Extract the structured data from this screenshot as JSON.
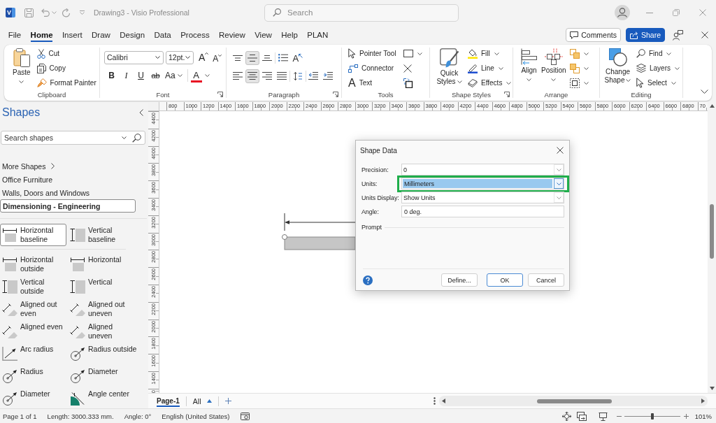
{
  "title_bar": {
    "logo": "V",
    "title": "Drawing3 - Visio Professional",
    "search": {
      "placeholder": "Search"
    }
  },
  "menu_tabs": [
    {
      "label": "File",
      "selected": false
    },
    {
      "label": "Home",
      "selected": true
    },
    {
      "label": "Insert",
      "selected": false
    },
    {
      "label": "Draw",
      "selected": false
    },
    {
      "label": "Design",
      "selected": false
    },
    {
      "label": "Data",
      "selected": false
    },
    {
      "label": "Process",
      "selected": false
    },
    {
      "label": "Review",
      "selected": false
    },
    {
      "label": "View",
      "selected": false
    },
    {
      "label": "Help",
      "selected": false
    },
    {
      "label": "PLAN",
      "selected": false
    }
  ],
  "header_buttons": [
    {
      "label": "Comments",
      "kind": "outline"
    },
    {
      "label": "Share",
      "kind": "primary"
    }
  ],
  "ribbon": {
    "groups": [
      {
        "kind": "clipboard",
        "label": "Clipboard",
        "big_button": "Paste",
        "buttons": [
          "Cut",
          "Copy",
          "Format Painter"
        ]
      },
      {
        "kind": "font",
        "label": "Font",
        "font": "Calibri",
        "size": "12pt.",
        "grow": "A",
        "shrink": "A",
        "styles": [
          "B",
          "I",
          "U",
          "ab",
          "Aa"
        ],
        "color_letter": "A"
      },
      {
        "kind": "paragraph",
        "label": "Paragraph",
        "vertical_align": [
          {
            "selected": false
          },
          {
            "selected": true
          },
          {
            "selected": false
          }
        ],
        "text_direction": "A",
        "horizontal_align": [
          {
            "selected": false
          },
          {
            "selected": true
          },
          {
            "selected": false
          },
          {
            "selected": false
          }
        ]
      },
      {
        "kind": "tools",
        "label": "Tools",
        "buttons": [
          "Pointer Tool",
          "Connector",
          "Text"
        ],
        "text_icon": "A"
      },
      {
        "kind": "shape_styles",
        "label": "Shape Styles",
        "big_button": "Quick Styles",
        "buttons": [
          "Fill",
          "Line",
          "Effects"
        ]
      },
      {
        "kind": "arrange",
        "label": "Arrange",
        "big_buttons": [
          "Align",
          "Position"
        ]
      },
      {
        "kind": "editing",
        "label": "Editing",
        "big_button": "Change Shape",
        "buttons": [
          "Find",
          "Layers",
          "Select"
        ]
      }
    ]
  },
  "shapes_panel": {
    "title": "Shapes",
    "search": {
      "placeholder": "Search shapes"
    },
    "more_shapes": "More Shapes",
    "stencils": [
      {
        "label": "Office Furniture",
        "selected": false
      },
      {
        "label": "Walls, Doors and Windows",
        "selected": false
      },
      {
        "label": "Dimensioning - Engineering",
        "selected": true
      }
    ],
    "master_groups": [
      {
        "items": [
          {
            "label": "Horizontal baseline",
            "selected": true
          },
          {
            "label": "Vertical baseline",
            "selected": false
          }
        ]
      },
      {
        "items": [
          {
            "label": "Horizontal outside",
            "selected": false
          },
          {
            "label": "Horizontal",
            "selected": false
          },
          {
            "label": "Vertical outside",
            "selected": false
          },
          {
            "label": "Vertical",
            "selected": false
          },
          {
            "label": "Aligned out even",
            "selected": false
          },
          {
            "label": "Aligned out uneven",
            "selected": false
          },
          {
            "label": "Aligned even",
            "selected": false
          },
          {
            "label": "Aligned uneven",
            "selected": false
          },
          {
            "label": "Arc radius",
            "selected": false
          },
          {
            "label": "Radius outside",
            "selected": false
          },
          {
            "label": "Radius",
            "selected": false
          },
          {
            "label": "Diameter",
            "selected": false
          },
          {
            "label": "Diameter",
            "selected": false
          },
          {
            "label": "Angle center",
            "selected": false
          }
        ]
      }
    ]
  },
  "rulers": {
    "horizontal": [
      "800",
      "1000",
      "1200",
      "1400",
      "1600",
      "1800",
      "2000",
      "2200",
      "2400",
      "2600",
      "2800",
      "3000",
      "3200",
      "3400",
      "3600",
      "3800",
      "4000",
      "4200",
      "4400",
      "4600",
      "4800",
      "5000",
      "5200",
      "5400",
      "5600",
      "5800",
      "6000",
      "6200",
      "6400",
      "6600",
      "6800",
      "70"
    ],
    "vertical": [
      "4400",
      "4200",
      "4000",
      "3800",
      "3600",
      "3400",
      "3200",
      "3000",
      "2800",
      "2600",
      "2400",
      "2200",
      "2000",
      "1800",
      "1600",
      "1400",
      "0"
    ]
  },
  "dialog": {
    "title": "Shape Data",
    "fields": [
      {
        "label": "Precision:",
        "value": "0",
        "kind": "dropdown",
        "selected": false,
        "highlighted": false
      },
      {
        "label": "Units:",
        "value": "Millimeters",
        "kind": "dropdown",
        "selected": true,
        "highlighted": true
      },
      {
        "label": "Units Display:",
        "value": "Show Units",
        "kind": "dropdown",
        "selected": false,
        "highlighted": false
      },
      {
        "label": "Angle:",
        "value": "0 deg.",
        "kind": "text",
        "selected": false,
        "highlighted": false
      }
    ],
    "prompt_label": "Prompt",
    "buttons": [
      {
        "label": "Define...",
        "default": false
      },
      {
        "label": "OK",
        "default": true
      },
      {
        "label": "Cancel",
        "default": false
      }
    ]
  },
  "page_tabs": {
    "tabs": [
      {
        "label": "Page-1",
        "selected": true
      }
    ],
    "all": "All"
  },
  "status_bar": {
    "items": [
      "Page 1 of 1",
      "Length: 3000.333 mm.",
      "Angle: 0°",
      "English (United States)"
    ],
    "zoom": {
      "level": 0.5,
      "reading": "101%"
    }
  }
}
